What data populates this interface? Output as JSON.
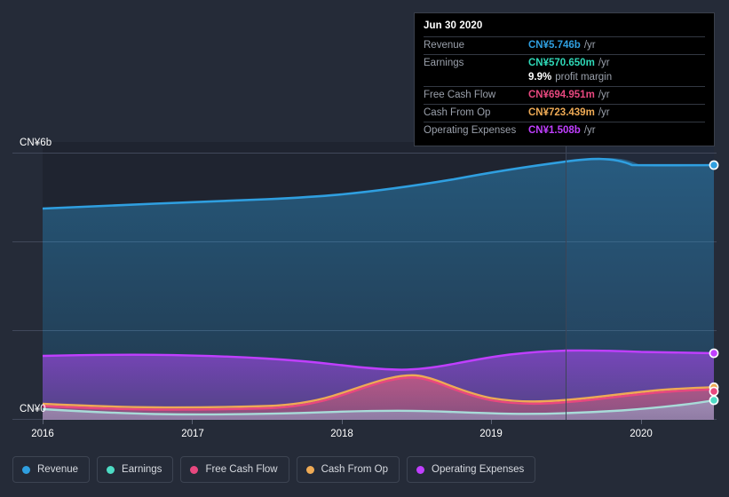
{
  "background": "#252b38",
  "axes": {
    "y_top_label": "CN¥6b",
    "y_zero_label": "CN¥0",
    "x_labels": [
      "2016",
      "2017",
      "2018",
      "2019",
      "2020"
    ]
  },
  "tooltip": {
    "date": "Jun 30 2020",
    "rows": [
      {
        "label": "Revenue",
        "value": "CN¥5.746b",
        "unit": "/yr",
        "color": "#2f9fe0"
      },
      {
        "label": "Earnings",
        "value": "CN¥570.650m",
        "unit": "/yr",
        "color": "#2fd9b8"
      },
      {
        "label": "",
        "value": "9.9%",
        "unit": "profit margin",
        "color": "#ffffff"
      },
      {
        "label": "Free Cash Flow",
        "value": "CN¥694.951m",
        "unit": "/yr",
        "color": "#e8487f"
      },
      {
        "label": "Cash From Op",
        "value": "CN¥723.439m",
        "unit": "/yr",
        "color": "#eeaa55"
      },
      {
        "label": "Operating Expenses",
        "value": "CN¥1.508b",
        "unit": "/yr",
        "color": "#c03fff"
      }
    ]
  },
  "legend": {
    "items": [
      {
        "label": "Revenue",
        "color": "#2f9fe0"
      },
      {
        "label": "Earnings",
        "color": "#4ddbc4"
      },
      {
        "label": "Free Cash Flow",
        "color": "#e8487f"
      },
      {
        "label": "Cash From Op",
        "color": "#eeaa55"
      },
      {
        "label": "Operating Expenses",
        "color": "#c03fff"
      }
    ]
  },
  "chart_data": {
    "type": "area",
    "title": "",
    "xlabel": "",
    "ylabel": "CN¥",
    "currency": "CN¥",
    "ylim": [
      0,
      6000000000
    ],
    "y_ticks": [
      0,
      2000000000,
      4000000000,
      6000000000
    ],
    "y_tick_labels": [
      "CN¥0",
      "",
      "",
      "CN¥6b"
    ],
    "grid": true,
    "legend_position": "bottom",
    "x_tick_labels": [
      "2016",
      "2017",
      "2018",
      "2019",
      "2020"
    ],
    "x": [
      "2016-01-01",
      "2016-06-30",
      "2016-12-31",
      "2017-06-30",
      "2017-12-31",
      "2018-06-30",
      "2018-12-31",
      "2019-06-30",
      "2019-12-31",
      "2020-06-30"
    ],
    "forecast_boundary": "2019-06-30",
    "highlighted_point": "2020-06-30",
    "series": [
      {
        "name": "Revenue",
        "color": "#2f9fe0",
        "unit": "CN¥",
        "values": [
          4.74,
          4.79,
          4.84,
          4.88,
          4.93,
          5.02,
          5.21,
          5.45,
          5.68,
          5.746
        ],
        "value_labels": [
          "CN¥4.74b",
          "CN¥4.79b",
          "CN¥4.84b",
          "CN¥4.88b",
          "CN¥4.93b",
          "CN¥5.02b",
          "CN¥5.21b",
          "CN¥5.45b",
          "CN¥5.68b",
          "CN¥5.746b"
        ]
      },
      {
        "name": "Earnings",
        "color": "#4ddbc4",
        "unit": "CN¥",
        "values": [
          0.225,
          0.185,
          0.16,
          0.155,
          0.17,
          0.2,
          0.205,
          0.2,
          0.33,
          0.571
        ],
        "value_labels": [
          "CN¥225m",
          "CN¥185m",
          "CN¥160m",
          "CN¥155m",
          "CN¥170m",
          "CN¥200m",
          "CN¥205m",
          "CN¥200m",
          "CN¥330m",
          "CN¥570.650m"
        ]
      },
      {
        "name": "Free Cash Flow",
        "color": "#e8487f",
        "unit": "CN¥",
        "values": [
          0.3,
          0.26,
          0.25,
          0.26,
          0.38,
          0.78,
          0.52,
          0.42,
          0.52,
          0.695
        ],
        "value_labels": [
          "CN¥300m",
          "CN¥260m",
          "CN¥250m",
          "CN¥260m",
          "CN¥380m",
          "CN¥780m",
          "CN¥520m",
          "CN¥420m",
          "CN¥520m",
          "CN¥694.951m"
        ]
      },
      {
        "name": "Cash From Op",
        "color": "#eeaa55",
        "unit": "CN¥",
        "values": [
          0.35,
          0.3,
          0.285,
          0.3,
          0.42,
          0.82,
          0.56,
          0.46,
          0.56,
          0.723
        ],
        "value_labels": [
          "CN¥350m",
          "CN¥300m",
          "CN¥285m",
          "CN¥300m",
          "CN¥420m",
          "CN¥820m",
          "CN¥560m",
          "CN¥460m",
          "CN¥560m",
          "CN¥723.439m"
        ]
      },
      {
        "name": "Operating Expenses",
        "color": "#c03fff",
        "unit": "CN¥",
        "values": [
          1.42,
          1.45,
          1.46,
          1.44,
          1.38,
          1.28,
          1.45,
          1.53,
          1.52,
          1.508
        ],
        "value_labels": [
          "CN¥1.42b",
          "CN¥1.45b",
          "CN¥1.46b",
          "CN¥1.44b",
          "CN¥1.38b",
          "CN¥1.28b",
          "CN¥1.45b",
          "CN¥1.53b",
          "CN¥1.52b",
          "CN¥1.508b"
        ]
      }
    ]
  }
}
